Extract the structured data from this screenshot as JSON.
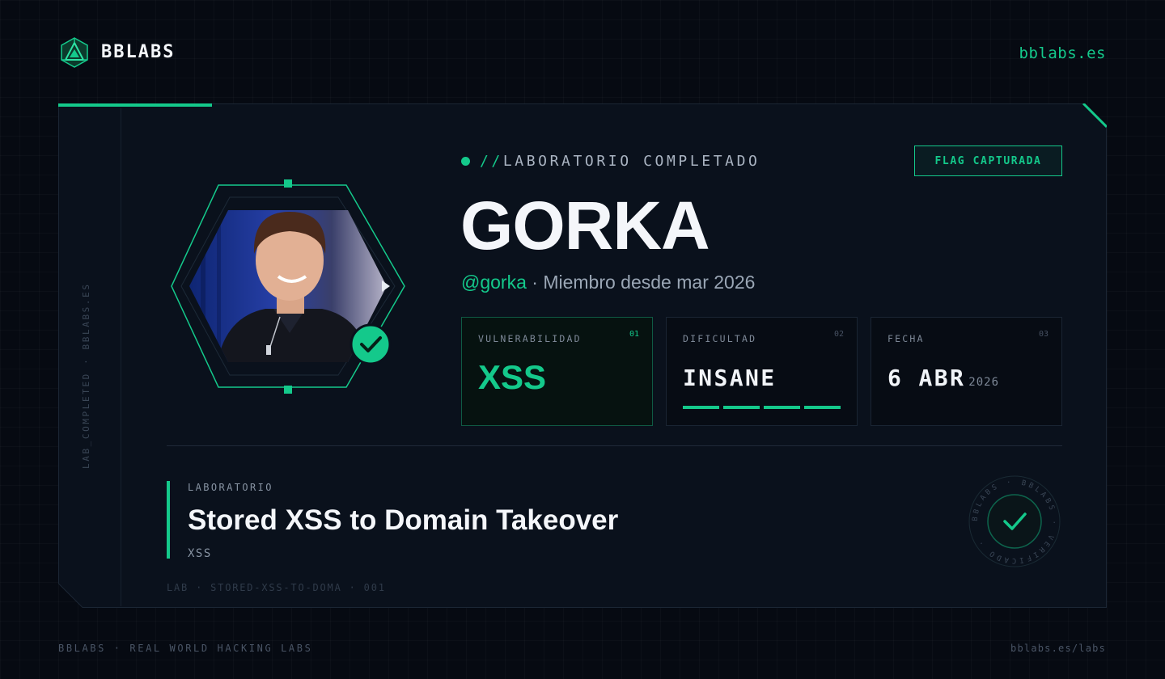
{
  "header": {
    "brand": "BBLABS",
    "site": "bblabs.es",
    "logo_icon": "bblabs-logo-icon"
  },
  "card": {
    "side_text": "LAB_COMPLETED · BBLABS.ES",
    "status_slashes": "//",
    "status_text": "LABORATORIO COMPLETADO",
    "flag_badge": "FLAG CAPTURADA",
    "username": "GORKA",
    "handle": "@gorka",
    "member_since": "· Miembro desde mar 2026",
    "stats": [
      {
        "label": "VULNERABILIDAD",
        "num": "01",
        "value": "XSS"
      },
      {
        "label": "DIFICULTAD",
        "num": "02",
        "value": "INSANE",
        "level": 4,
        "max_level": 4
      },
      {
        "label": "FECHA",
        "num": "03",
        "value": "6 ABR",
        "year": "2026"
      }
    ],
    "lab": {
      "label": "LABORATORIO",
      "title": "Stored XSS to Domain Takeover",
      "category": "XSS",
      "id": "LAB · STORED-XSS-TO-DOMA · 001"
    },
    "seal_text": "BBLABS · BBLABS · VERIFICADO ·"
  },
  "footer": {
    "left": "BBLABS · REAL WORLD HACKING LABS",
    "right": "bblabs.es/labs"
  },
  "colors": {
    "accent": "#14c98b",
    "background": "#060a12",
    "card": "#0a111c"
  }
}
